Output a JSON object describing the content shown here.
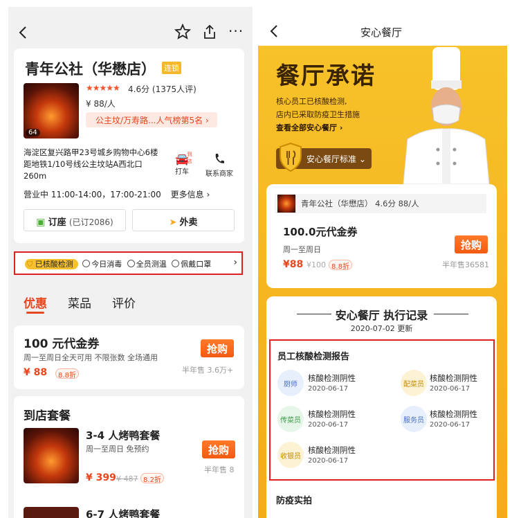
{
  "left": {
    "restaurant": {
      "name": "青年公社（华懋店）",
      "chain_badge": "连锁",
      "photo_count": "64",
      "stars": "★★★★★",
      "score": "4.6分 (1375人评)",
      "price": "¥ 88/人",
      "rank": "公主坟/万寿路...人气榜第5名",
      "address": "海淀区复兴路甲23号城乡购物中心6楼距地铁1/10号线公主坟站A西北口260m",
      "taxi_label": "打车",
      "taxi_badge": "到店",
      "contact_label": "联系商家",
      "hours": "营业中   11:00-14:00，17:00-21:00",
      "more_info": "更多信息",
      "reserve_label": "订座",
      "reserve_count": "(已订2086)",
      "takeout_label": "外卖"
    },
    "safety": {
      "badge": "已核酸检测",
      "items": [
        "今日消毒",
        "全员测温",
        "佩戴口罩"
      ]
    },
    "tabs": [
      "优惠",
      "菜品",
      "评价"
    ],
    "voucher": {
      "title": "100 元代金券",
      "desc": "周一至周日全天可用  不限张数  全场通用",
      "price": "¥ 88",
      "discount": "8.8折",
      "button": "抢购",
      "sold": "半年售 3.6万+"
    },
    "set_meals": {
      "title": "到店套餐",
      "item1": {
        "name": "3-4 人烤鸭套餐",
        "desc": "周一至周日  免预约",
        "price": "¥ 399",
        "original": "¥ 487",
        "discount": "8.2折",
        "button": "抢购",
        "sold": "半年售 8"
      },
      "item2_name": "6-7 人烤鸭套餐"
    }
  },
  "right": {
    "nav_title": "安心餐厅",
    "banner": {
      "title": "餐厅承诺",
      "line1": "核心员工已核酸检测,",
      "line2": "店内已采取防疫卫生措施",
      "link": "查看全部安心餐厅",
      "standard_label": "安心餐厅标准"
    },
    "coupon": {
      "shop_line": "青年公社（华懋店）  4.6分  88/人",
      "title": "100.0元代金券",
      "desc": "周一至周日",
      "price": "¥88",
      "original": "¥100",
      "discount": "8.8折",
      "button": "抢购",
      "sold": "半年售36581"
    },
    "records": {
      "title": "安心餐厅 执行记录",
      "date": "2020-07-02 更新",
      "report_title": "员工核酸检测报告",
      "staff": [
        {
          "role": "厨师",
          "result": "核酸检测阴性",
          "date": "2020-06-17"
        },
        {
          "role": "配菜员",
          "result": "核酸检测阴性",
          "date": "2020-06-17"
        },
        {
          "role": "传菜员",
          "result": "核酸检测阴性",
          "date": "2020-06-17"
        },
        {
          "role": "服务员",
          "result": "核酸检测阴性",
          "date": "2020-06-17"
        },
        {
          "role": "收银员",
          "result": "核酸检测阴性",
          "date": "2020-06-17"
        }
      ],
      "section2_title": "防疫实拍"
    }
  },
  "colors": {
    "accent": "#e8461e",
    "banner_yellow": "#f6b81c",
    "safety_red": "#e02020"
  }
}
